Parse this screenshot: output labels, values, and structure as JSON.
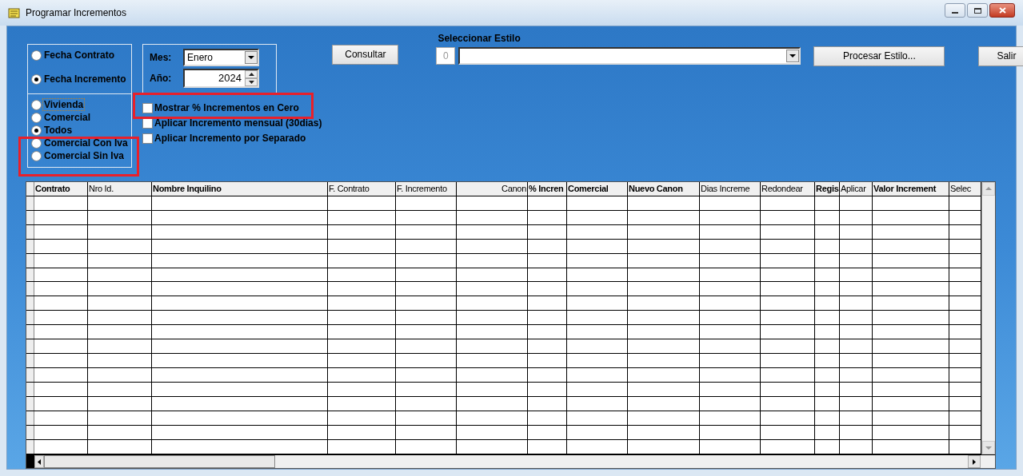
{
  "window": {
    "title": "Programar Incrementos"
  },
  "fecha_options": [
    {
      "label": "Fecha Contrato",
      "selected": false
    },
    {
      "label": "Fecha Incremento",
      "selected": true
    }
  ],
  "tipo_options": [
    {
      "label": "Vivienda",
      "selected": false,
      "focused": true
    },
    {
      "label": "Comercial",
      "selected": false,
      "focused": false
    },
    {
      "label": "Todos",
      "selected": true,
      "focused": false
    },
    {
      "label": "Comercial Con Iva",
      "selected": false,
      "focused": false
    },
    {
      "label": "Comercial Sin Iva",
      "selected": false,
      "focused": false
    }
  ],
  "mes": {
    "label": "Mes:",
    "value": "Enero"
  },
  "anio": {
    "label": "Año:",
    "value": "2024"
  },
  "checkboxes": [
    {
      "label": "Mostrar % Incrementos en Cero",
      "checked": false
    },
    {
      "label": "Aplicar Incremento mensual (30dias)",
      "checked": false
    },
    {
      "label": "Aplicar Incremento por Separado",
      "checked": false
    }
  ],
  "consultar_button": "Consultar",
  "estilo": {
    "label": "Seleccionar Estilo",
    "number": "0"
  },
  "procesar_button": "Procesar Estilo...",
  "salir_button": "Salir",
  "table": {
    "columns": [
      {
        "label": "Contrato",
        "bold": true
      },
      {
        "label": "Nro Id.",
        "bold": false
      },
      {
        "label": "Nombre Inquilino",
        "bold": true
      },
      {
        "label": "F. Contrato",
        "bold": false
      },
      {
        "label": "F. Incremento",
        "bold": false
      },
      {
        "label": "Canon",
        "bold": false
      },
      {
        "label": "% Incren",
        "bold": true
      },
      {
        "label": "Comercial",
        "bold": true
      },
      {
        "label": "Nuevo Canon",
        "bold": true
      },
      {
        "label": "Dias Increme",
        "bold": false
      },
      {
        "label": "Redondear",
        "bold": false
      },
      {
        "label": "Regis",
        "bold": true
      },
      {
        "label": "Aplicar",
        "bold": false
      },
      {
        "label": "Valor Increment",
        "bold": true
      },
      {
        "label": "Selec",
        "bold": false
      }
    ]
  }
}
